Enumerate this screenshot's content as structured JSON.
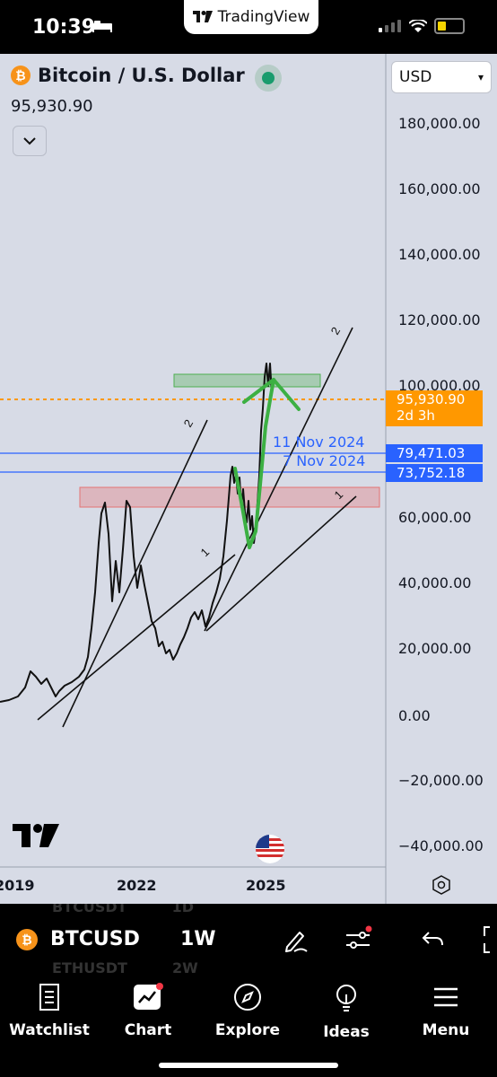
{
  "status_bar": {
    "time": "10:39",
    "app_badge": "TradingView"
  },
  "symbol": {
    "title": "Bitcoin / U.S. Dollar",
    "price": "95,930.90"
  },
  "currency": {
    "selected": "USD"
  },
  "y_axis": {
    "labels": [
      "180,000.00",
      "160,000.00",
      "140,000.00",
      "120,000.00",
      "100,000.00",
      "60,000.00",
      "40,000.00",
      "20,000.00",
      "0.00",
      "−20,000.00",
      "−40,000.00"
    ]
  },
  "price_tags": {
    "current": {
      "price": "95,930.90",
      "countdown": "2d 3h",
      "color": "#ff9800"
    },
    "line1": {
      "price": "79,471.03",
      "date": "11 Nov 2024",
      "color": "#2962ff"
    },
    "line2": {
      "price": "73,752.18",
      "date": "7 Nov 2024",
      "color": "#2962ff"
    }
  },
  "x_axis": {
    "labels": [
      "2019",
      "2022",
      "2025"
    ]
  },
  "annotations": {
    "wave_2_a": "2",
    "wave_1_a": "1",
    "wave_2_b": "2",
    "wave_1_b": "1"
  },
  "toolbar": {
    "symbol": "BTCUSD",
    "interval": "1W",
    "ghost_rows": [
      [
        "BTCUSDT",
        "1D"
      ],
      [
        "ETHUSDT",
        "2W"
      ]
    ]
  },
  "bottom_nav": [
    {
      "label": "Watchlist",
      "icon": "watchlist-icon"
    },
    {
      "label": "Chart",
      "icon": "chart-icon"
    },
    {
      "label": "Explore",
      "icon": "compass-icon"
    },
    {
      "label": "Ideas",
      "icon": "lightbulb-icon"
    },
    {
      "label": "Menu",
      "icon": "menu-icon"
    }
  ],
  "colors": {
    "chart_bg": "#d7dbe6",
    "green_zone": "#4caf50",
    "red_zone": "#e57373",
    "accent_blue": "#2962ff"
  }
}
